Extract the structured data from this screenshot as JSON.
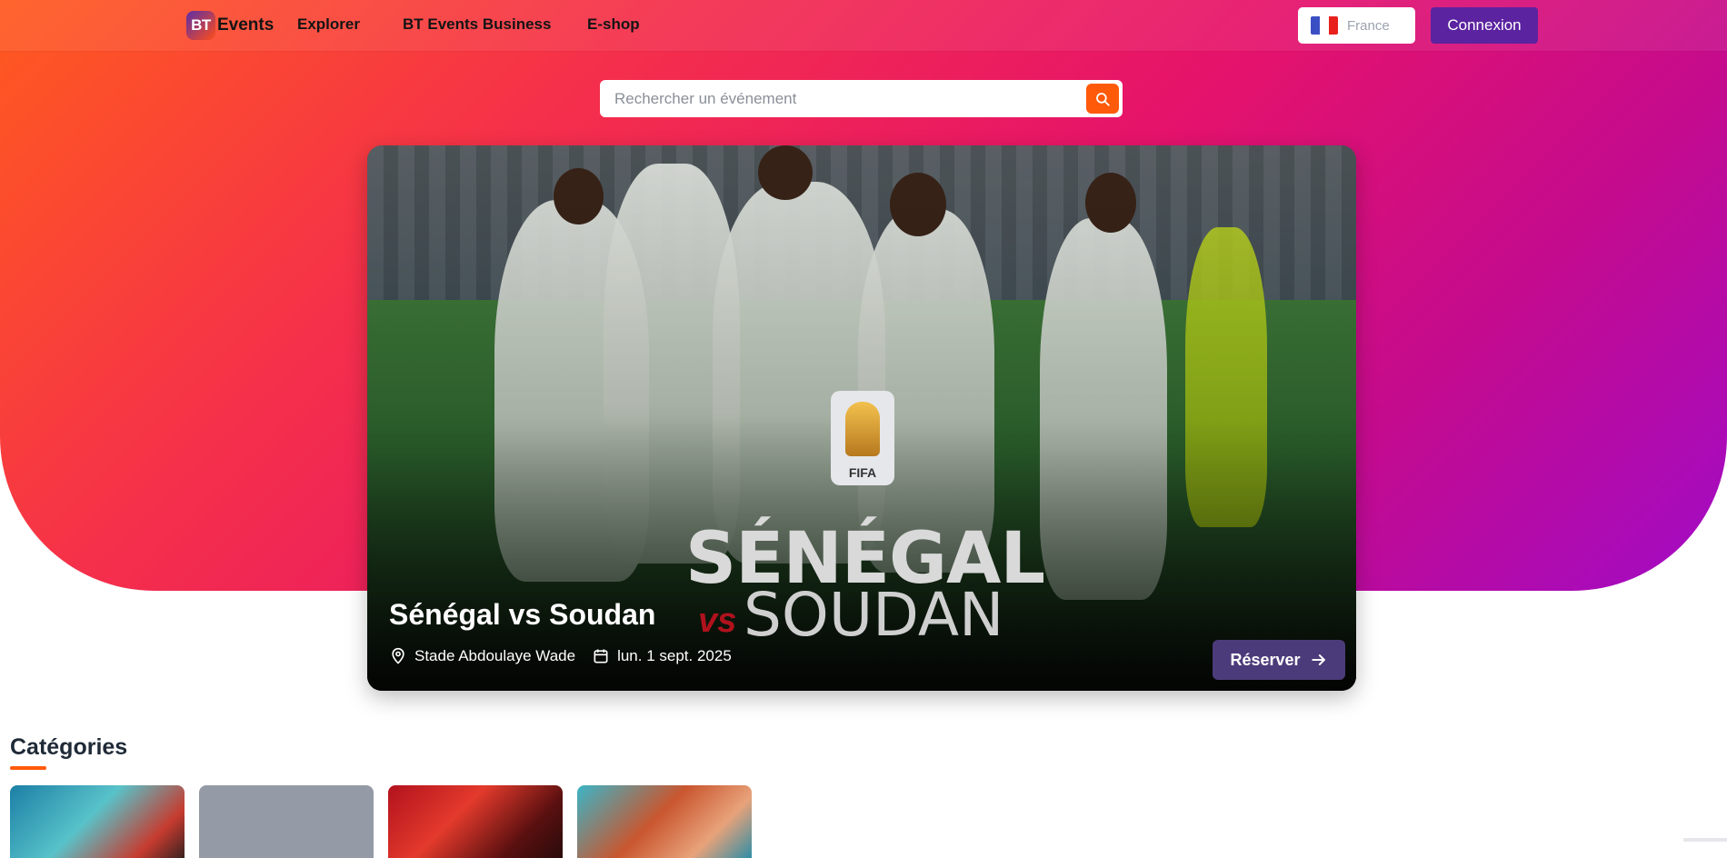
{
  "header": {
    "logo_badge": "BT",
    "logo_text": "Events",
    "nav": [
      "Explorer",
      "BT Events Business",
      "E-shop"
    ],
    "language": "France",
    "login": "Connexion",
    "flag_colors": [
      "#3b4fc4",
      "#ffffff",
      "#e8211d"
    ]
  },
  "search": {
    "placeholder": "Rechercher un événement",
    "icon": "search-icon"
  },
  "featured": {
    "title": "Sénégal vs Soudan",
    "venue": "Stade Abdoulaye Wade",
    "date": "lun. 1 sept. 2025",
    "cta": "Réserver",
    "poster": {
      "emblem": "FIFA",
      "team1": "SÉNÉGAL",
      "vs": "vs",
      "team2": "SOUDAN"
    }
  },
  "categories": {
    "title": "Catégories"
  },
  "colors": {
    "accent": "#ff5a0a",
    "brand_purple": "#5b23a0",
    "cta": "#4c3b7a"
  }
}
